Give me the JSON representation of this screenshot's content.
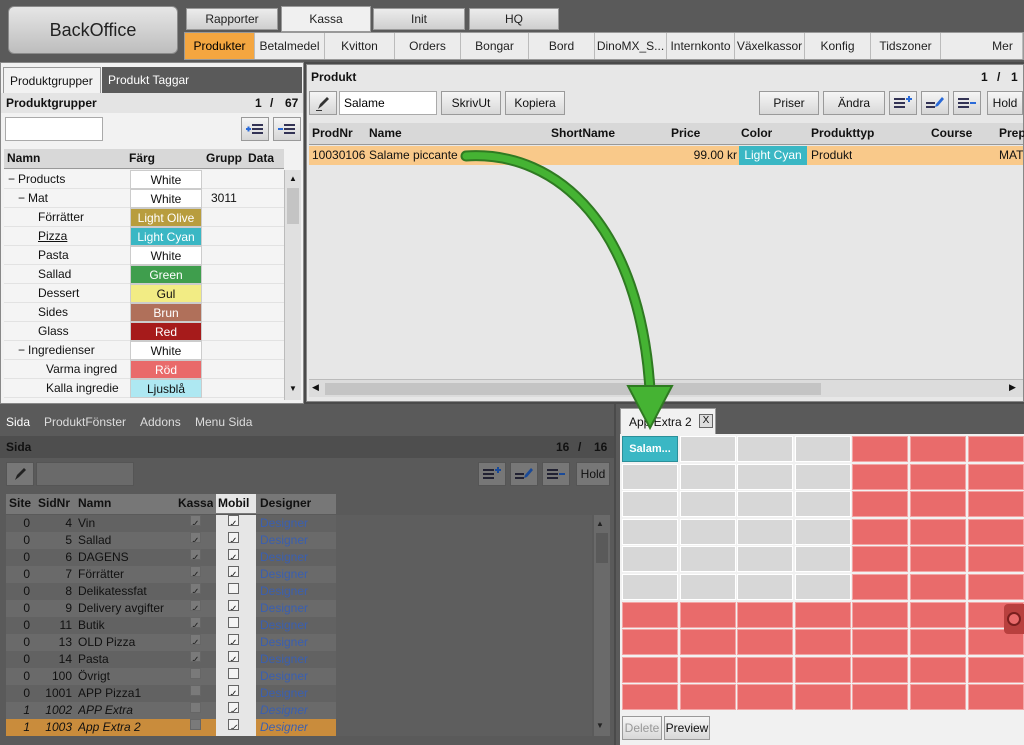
{
  "app": {
    "title": "BackOffice"
  },
  "main_tabs": [
    "Rapporter",
    "Kassa",
    "Init",
    "HQ"
  ],
  "sub_tabs": [
    "Produkter",
    "Betalmedel",
    "Kvitton",
    "Orders",
    "Bongar",
    "Bord",
    "DinoMX_S...",
    "Internkonto",
    "Växelkassor",
    "Konfig",
    "Tidszoner",
    "Mer"
  ],
  "left": {
    "tabs": [
      "Produktgrupper",
      "Produkt Taggar"
    ],
    "title": "Produktgrupper",
    "page": "1",
    "sep": "/",
    "total": "67",
    "columns": [
      "Namn",
      "Färg",
      "Grupp",
      "Data"
    ],
    "rows": [
      {
        "prefix": "−",
        "name": "Products",
        "color": "White",
        "bg": "#ffffff",
        "fg": "#111111",
        "grupp": ""
      },
      {
        "prefix": "−",
        "name": "Mat",
        "color": "White",
        "bg": "#ffffff",
        "fg": "#111111",
        "grupp": "3011"
      },
      {
        "prefix": "",
        "name": "Förrätter",
        "color": "Light Olive",
        "bg": "#b89d3e",
        "fg": "#ffffff",
        "grupp": ""
      },
      {
        "prefix": "",
        "name": "Pizza",
        "color": "Light Cyan",
        "bg": "#3ab7c4",
        "fg": "#ffffff",
        "grupp": ""
      },
      {
        "prefix": "",
        "name": "Pasta",
        "color": "White",
        "bg": "#ffffff",
        "fg": "#111111",
        "grupp": ""
      },
      {
        "prefix": "",
        "name": "Sallad",
        "color": "Green",
        "bg": "#3f9e4d",
        "fg": "#ffffff",
        "grupp": ""
      },
      {
        "prefix": "",
        "name": "Dessert",
        "color": "Gul",
        "bg": "#f2ec84",
        "fg": "#111111",
        "grupp": ""
      },
      {
        "prefix": "",
        "name": "Sides",
        "color": "Brun",
        "bg": "#b0705a",
        "fg": "#ffffff",
        "grupp": ""
      },
      {
        "prefix": "",
        "name": "Glass",
        "color": "Red",
        "bg": "#a61b1b",
        "fg": "#ffffff",
        "grupp": ""
      },
      {
        "prefix": "−",
        "name": "Ingredienser",
        "color": "White",
        "bg": "#ffffff",
        "fg": "#111111",
        "grupp": ""
      },
      {
        "prefix": "",
        "name": "Varma ingred",
        "color": "Röd",
        "bg": "#e96a6a",
        "fg": "#ffffff",
        "grupp": ""
      },
      {
        "prefix": "",
        "name": "Kalla ingredie",
        "color": "Ljusblå",
        "bg": "#aee8f2",
        "fg": "#111111",
        "grupp": ""
      }
    ]
  },
  "product": {
    "title": "Produkt",
    "page": "1",
    "sep": "/",
    "total": "1",
    "search_value": "Salame",
    "buttons": {
      "print": "SkrivUt",
      "copy": "Kopiera",
      "prices": "Priser",
      "edit": "Ändra",
      "hold": "Hold"
    },
    "columns": [
      "ProdNr",
      "Name",
      "ShortName",
      "Price",
      "Color",
      "Produkttyp",
      "Course",
      "Prep"
    ],
    "row": {
      "prodnr": "10030106",
      "name": "Salame piccante",
      "shortname": "",
      "price": "99.00 kr",
      "color": "Light Cyan",
      "type": "Produkt",
      "course": "",
      "prep": "MAT"
    }
  },
  "sida": {
    "tabs": [
      "Sida",
      "ProduktFönster",
      "Addons",
      "Menu Sida"
    ],
    "title": "Sida",
    "page": "16",
    "sep": "/",
    "total": "16",
    "hold": "Hold",
    "columns": [
      "Site",
      "SidNr",
      "Namn",
      "Kassa",
      "Mobil",
      "Designer"
    ],
    "rows": [
      {
        "site": "0",
        "sidnr": "4",
        "namn": "Vin",
        "kassa": true,
        "mobil": true,
        "designer": "Designer"
      },
      {
        "site": "0",
        "sidnr": "5",
        "namn": "Sallad",
        "kassa": true,
        "mobil": true,
        "designer": "Designer"
      },
      {
        "site": "0",
        "sidnr": "6",
        "namn": "DAGENS",
        "kassa": true,
        "mobil": true,
        "designer": "Designer"
      },
      {
        "site": "0",
        "sidnr": "7",
        "namn": "Förrätter",
        "kassa": true,
        "mobil": true,
        "designer": "Designer"
      },
      {
        "site": "0",
        "sidnr": "8",
        "namn": "Delikatessfat",
        "kassa": true,
        "mobil": false,
        "designer": "Designer"
      },
      {
        "site": "0",
        "sidnr": "9",
        "namn": "Delivery avgifter",
        "kassa": true,
        "mobil": true,
        "designer": "Designer"
      },
      {
        "site": "0",
        "sidnr": "11",
        "namn": "Butik",
        "kassa": true,
        "mobil": false,
        "designer": "Designer"
      },
      {
        "site": "0",
        "sidnr": "13",
        "namn": "OLD Pizza",
        "kassa": true,
        "mobil": true,
        "designer": "Designer"
      },
      {
        "site": "0",
        "sidnr": "14",
        "namn": "Pasta",
        "kassa": true,
        "mobil": true,
        "designer": "Designer"
      },
      {
        "site": "0",
        "sidnr": "100",
        "namn": "Övrigt",
        "kassa": false,
        "mobil": false,
        "designer": "Designer"
      },
      {
        "site": "0",
        "sidnr": "1001",
        "namn": "APP Pizza1",
        "kassa": false,
        "mobil": true,
        "designer": "Designer"
      },
      {
        "site": "1",
        "sidnr": "1002",
        "namn": "APP Extra",
        "kassa": false,
        "mobil": true,
        "designer": "Designer"
      },
      {
        "site": "1",
        "sidnr": "1003",
        "namn": "App Extra 2",
        "kassa": false,
        "mobil": true,
        "designer": "Designer"
      }
    ]
  },
  "designer": {
    "tab_label": "App Extra 2",
    "close": "X",
    "button_label": "Salam...",
    "delete": "Delete",
    "preview": "Preview"
  },
  "colors": {
    "accent": "#f4a640",
    "row_selected": "#f9c98a",
    "arrow": "#3fa12e",
    "grid_red": "#e96b6b"
  }
}
